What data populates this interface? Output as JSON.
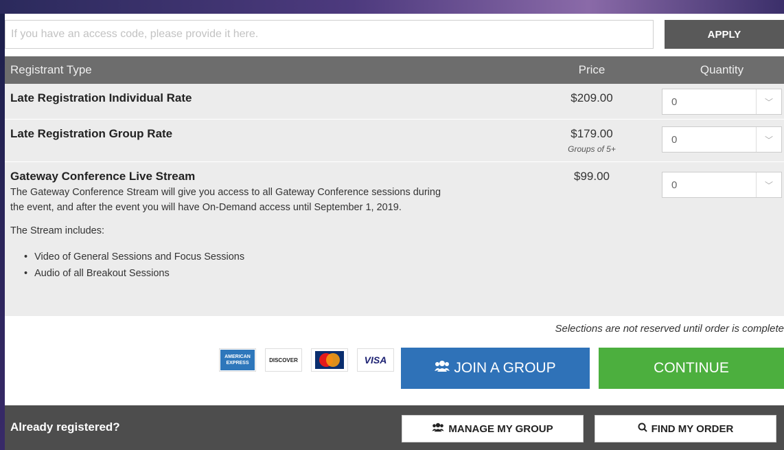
{
  "access": {
    "placeholder": "If you have an access code, please provide it here.",
    "apply_label": "APPLY"
  },
  "table": {
    "headers": {
      "type": "Registrant Type",
      "price": "Price",
      "quantity": "Quantity"
    },
    "rows": [
      {
        "title": "Late Registration Individual Rate",
        "price": "$209.00",
        "note": "",
        "quantity": "0"
      },
      {
        "title": "Late Registration Group Rate",
        "price": "$179.00",
        "note": "Groups of 5+",
        "quantity": "0"
      },
      {
        "title": "Gateway Conference Live Stream",
        "price": "$99.00",
        "note": "",
        "quantity": "0",
        "description_1": "The Gateway Conference Stream will give you access to all Gateway Conference sessions during",
        "description_2": "the event, and after the event you will have On-Demand access until September 1, 2019.",
        "description_3": "The Stream includes:",
        "bullets": [
          "Video of General Sessions and  Focus Sessions",
          "Audio of all Breakout Sessions"
        ]
      }
    ]
  },
  "selection_note": "Selections are not reserved until order is complete",
  "payment_cards": {
    "amex_line_1": "AMERICAN",
    "amex_line_2": "EXPRESS",
    "discover": "DISCOVER",
    "visa": "VISA"
  },
  "buttons": {
    "join_group": "JOIN A GROUP",
    "continue": "CONTINUE",
    "manage_group": "MANAGE MY GROUP",
    "find_order": "FIND MY ORDER"
  },
  "footer": {
    "label": "Already registered?"
  },
  "colors": {
    "join_button": "#2f72b8",
    "continue_button": "#4caf3e",
    "header_bar": "#6d6d6d",
    "footer_bar": "#4d4d4d",
    "apply_button": "#595959"
  }
}
